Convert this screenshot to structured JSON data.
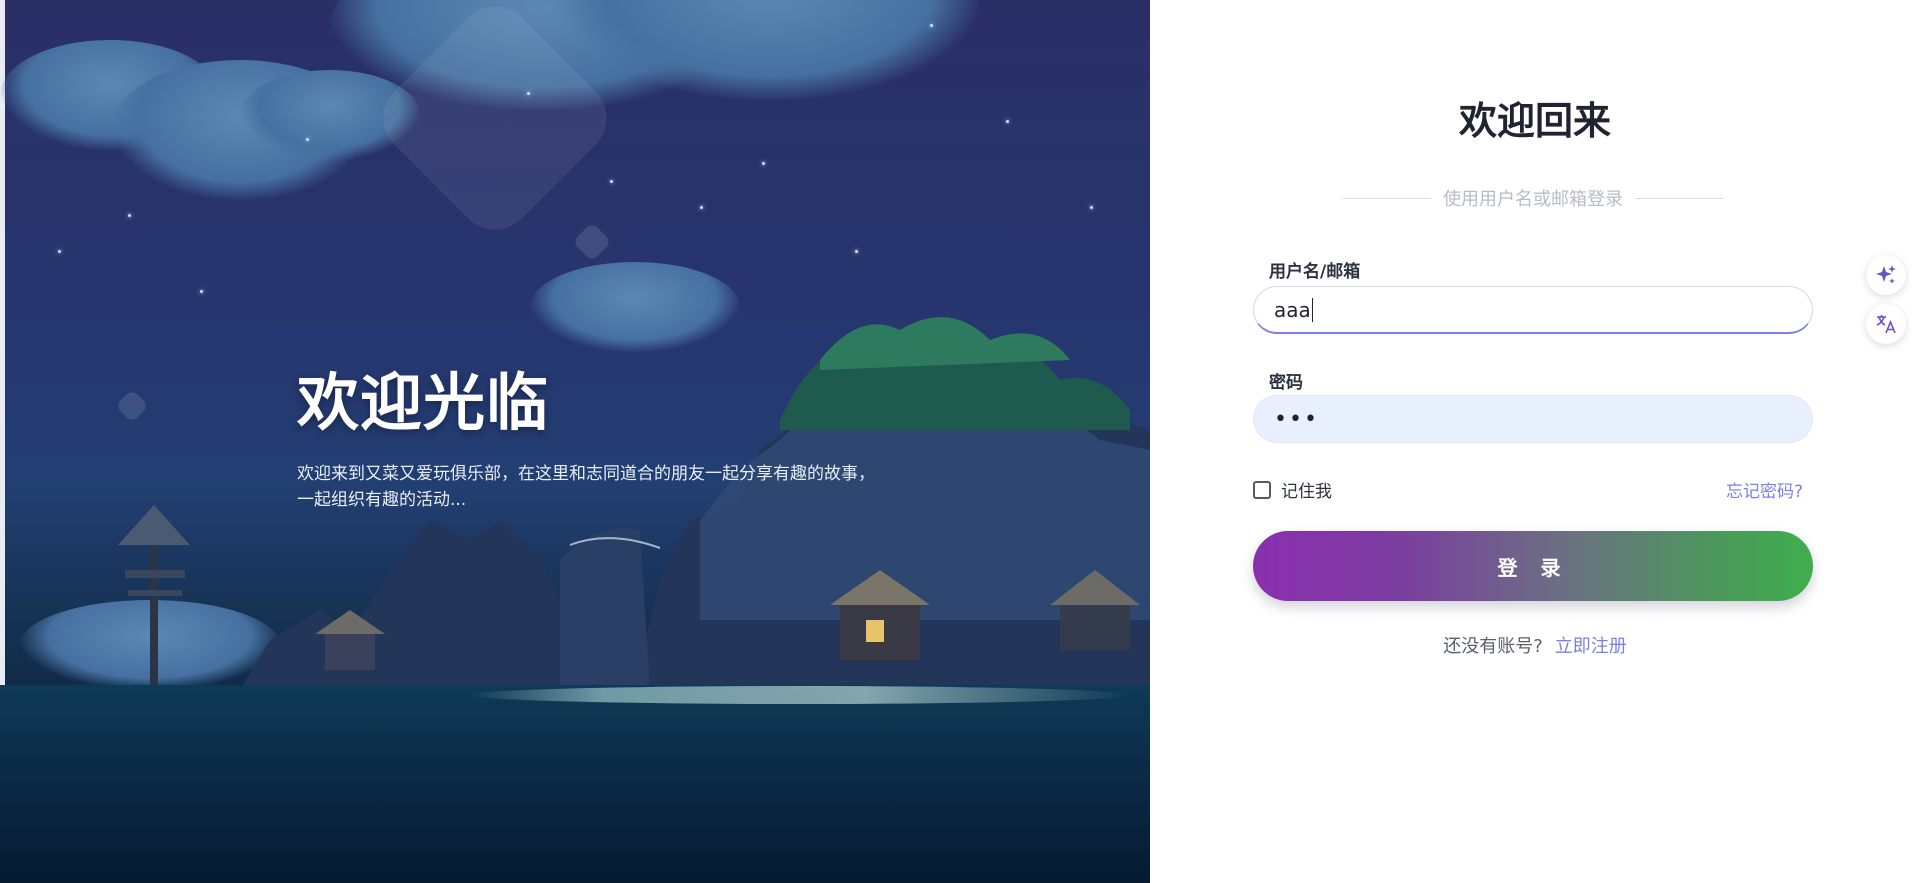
{
  "hero": {
    "title": "欢迎光临",
    "description": "欢迎来到又菜又爱玩俱乐部，在这里和志同道合的朋友一起分享有趣的故事，一起组织有趣的活动..."
  },
  "login": {
    "title": "欢迎回来",
    "subtitle": "使用用户名或邮箱登录",
    "username_label": "用户名/邮箱",
    "username_value": "aaa",
    "password_label": "密码",
    "password_value": "•••",
    "remember_label": "记住我",
    "remember_checked": false,
    "forgot_link": "忘记密码?",
    "submit_label": "登 录",
    "no_account_text": "还没有账号?",
    "register_link": "立即注册"
  },
  "side_buttons": [
    {
      "icon": "sparkle-icon",
      "color": "#6b4fc4"
    },
    {
      "icon": "translate-icon",
      "color": "#6b4fc4"
    }
  ],
  "colors": {
    "accent": "#7b7fe6",
    "button_gradient_start": "#8b2fb0",
    "button_gradient_end": "#3fae4e",
    "password_field_bg": "#e8f0fe"
  }
}
